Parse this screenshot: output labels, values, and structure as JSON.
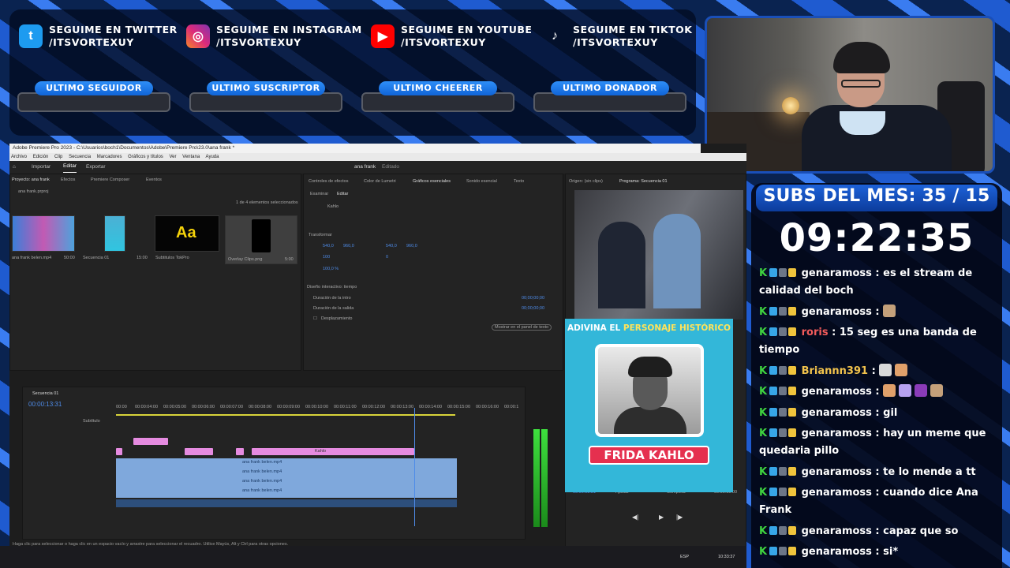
{
  "socials": [
    {
      "icon": "twitter-icon",
      "line1": "SEGUIME EN TWITTER",
      "line2": "/ITSVORTEXUY",
      "color": "#1d9bf0"
    },
    {
      "icon": "instagram-icon",
      "line1": "SEGUIME EN INSTAGRAM",
      "line2": "/ITSVORTEXUY",
      "color": "#d62976"
    },
    {
      "icon": "youtube-icon",
      "line1": "SEGUIME EN YOUTUBE",
      "line2": "/ITSVORTEXUY",
      "color": "#ff0000"
    },
    {
      "icon": "tiktok-icon",
      "line1": "SEGUIME EN TIKTOK",
      "line2": "/ITSVORTEXUY",
      "color": "#111111"
    }
  ],
  "stats_labels": [
    "ULTIMO SEGUIDOR",
    "ULTIMO SUSCRIPTOR",
    "ULTIMO CHEERER",
    "ULTIMO DONADOR"
  ],
  "subs": {
    "title": "SUBS DEL MES: 35 / 15",
    "timer": "09:22:35"
  },
  "chat": [
    {
      "user": "genaramoss",
      "text": "es el stream de calidad del boch",
      "color": "white"
    },
    {
      "user": "genaramoss",
      "text": "",
      "color": "white",
      "emotes": 1
    },
    {
      "user": "roris",
      "text": "15 seg es una banda de tiempo",
      "color": "red"
    },
    {
      "user": "Briannn391",
      "text": "",
      "color": "gold",
      "emotes": 2
    },
    {
      "user": "genaramoss",
      "text": "",
      "color": "white",
      "emotes": 4
    },
    {
      "user": "genaramoss",
      "text": "gil",
      "color": "white"
    },
    {
      "user": "genaramoss",
      "text": "hay un meme que quedaria pillo",
      "color": "white"
    },
    {
      "user": "genaramoss",
      "text": "te lo mende a tt",
      "color": "white"
    },
    {
      "user": "genaramoss",
      "text": "cuando dice Ana Frank",
      "color": "white"
    },
    {
      "user": "genaramoss",
      "text": "capaz que so",
      "color": "white"
    },
    {
      "user": "genaramoss",
      "text": "si*",
      "color": "white"
    }
  ],
  "premiere": {
    "title": "Adobe Premiere Pro 2023 - C:\\Usuarios\\boch1\\Documentos\\Adobe\\Premiere Pro\\23.0\\ana frank *",
    "menu": [
      "Archivo",
      "Edición",
      "Clip",
      "Secuencia",
      "Marcadores",
      "Gráficos y títulos",
      "Ver",
      "Ventana",
      "Ayuda"
    ],
    "tabs": [
      "Importar",
      "Editar",
      "Exportar"
    ],
    "project_name": "ana frank",
    "project_status": "Editado",
    "project_tabs": [
      "Proyecto: ana frank",
      "Efectos",
      "Premiere Composer",
      "Eventos"
    ],
    "project_file": "ana frank.prproj",
    "selection_count": "1 de 4 elementos seleccionados",
    "bin_items": [
      {
        "name": "ana frank belen.mp4",
        "dur": "50:00"
      },
      {
        "name": "Secuencia 01",
        "dur": "15:00"
      },
      {
        "name": "Subtitulos TokPro",
        "dur": ""
      },
      {
        "name": "Overlay Clips.png",
        "dur": "5:00"
      }
    ],
    "aa_label": "Aa",
    "eg_tabs": [
      "Controles de efectos",
      "Color de Lumetri",
      "Gráficos esenciales",
      "Sonido esencial",
      "Texto"
    ],
    "eg_subtabs": [
      "Examinar",
      "Editar"
    ],
    "eg_layer": "Kahlo",
    "transform_label": "Transformar",
    "transform_pos": [
      "540,0",
      "960,0"
    ],
    "transform_anchor": [
      "540,0",
      "960,0"
    ],
    "transform_scale": "100",
    "transform_rot": "0",
    "transform_opacity": "100,0 %",
    "responsive_label": "Diseño interactivo: tiempo",
    "intro_label": "Duración de la intro",
    "outro_label": "Duración de la salida",
    "scroll_label": "Desplazamiento",
    "intro_val": "00;00;00;00",
    "outro_val": "00;00;00;00",
    "show_text_btn": "Mostrar en el panel de texto",
    "source_tab": "Origen: (sin clips)",
    "program_tab": "Programa: Secuencia 01",
    "seq_name": "Secuencia 01",
    "timecode": "00:00:13:31",
    "program_time": "00:00:13:31",
    "program_dur": "00:00:15:00",
    "fit": "Ajustar",
    "quality": "Completa",
    "subtitle_track": "Subtítulo",
    "ruler": [
      "00:00",
      "00:00:04:00",
      "00:00:05:00",
      "00:00:06:00",
      "00:00:07:00",
      "00:00:08:00",
      "00:00:09:00",
      "00:00:10:00",
      "00:00:11:00",
      "00:00:12:00",
      "00:00:13:00",
      "00:00:14:00",
      "00:00:15:00",
      "00:00:16:00",
      "00:00:1"
    ],
    "clip_name": "ana frank belen.mp4",
    "kahlo_clip": "Kahlo",
    "status_bar": "Haga clic para seleccionar o haga clic en un espacio vacío y arrastre para seleccionar el recuadro. Utilice Mayús, Alt y Ctrl para otras opciones.",
    "clock": "10:33:37",
    "lang": "ESP"
  },
  "quiz": {
    "header_plain": "ADIVINA EL ",
    "header_highlight": "PERSONAJE HISTÓRICO",
    "name": "FRIDA KAHLO"
  }
}
